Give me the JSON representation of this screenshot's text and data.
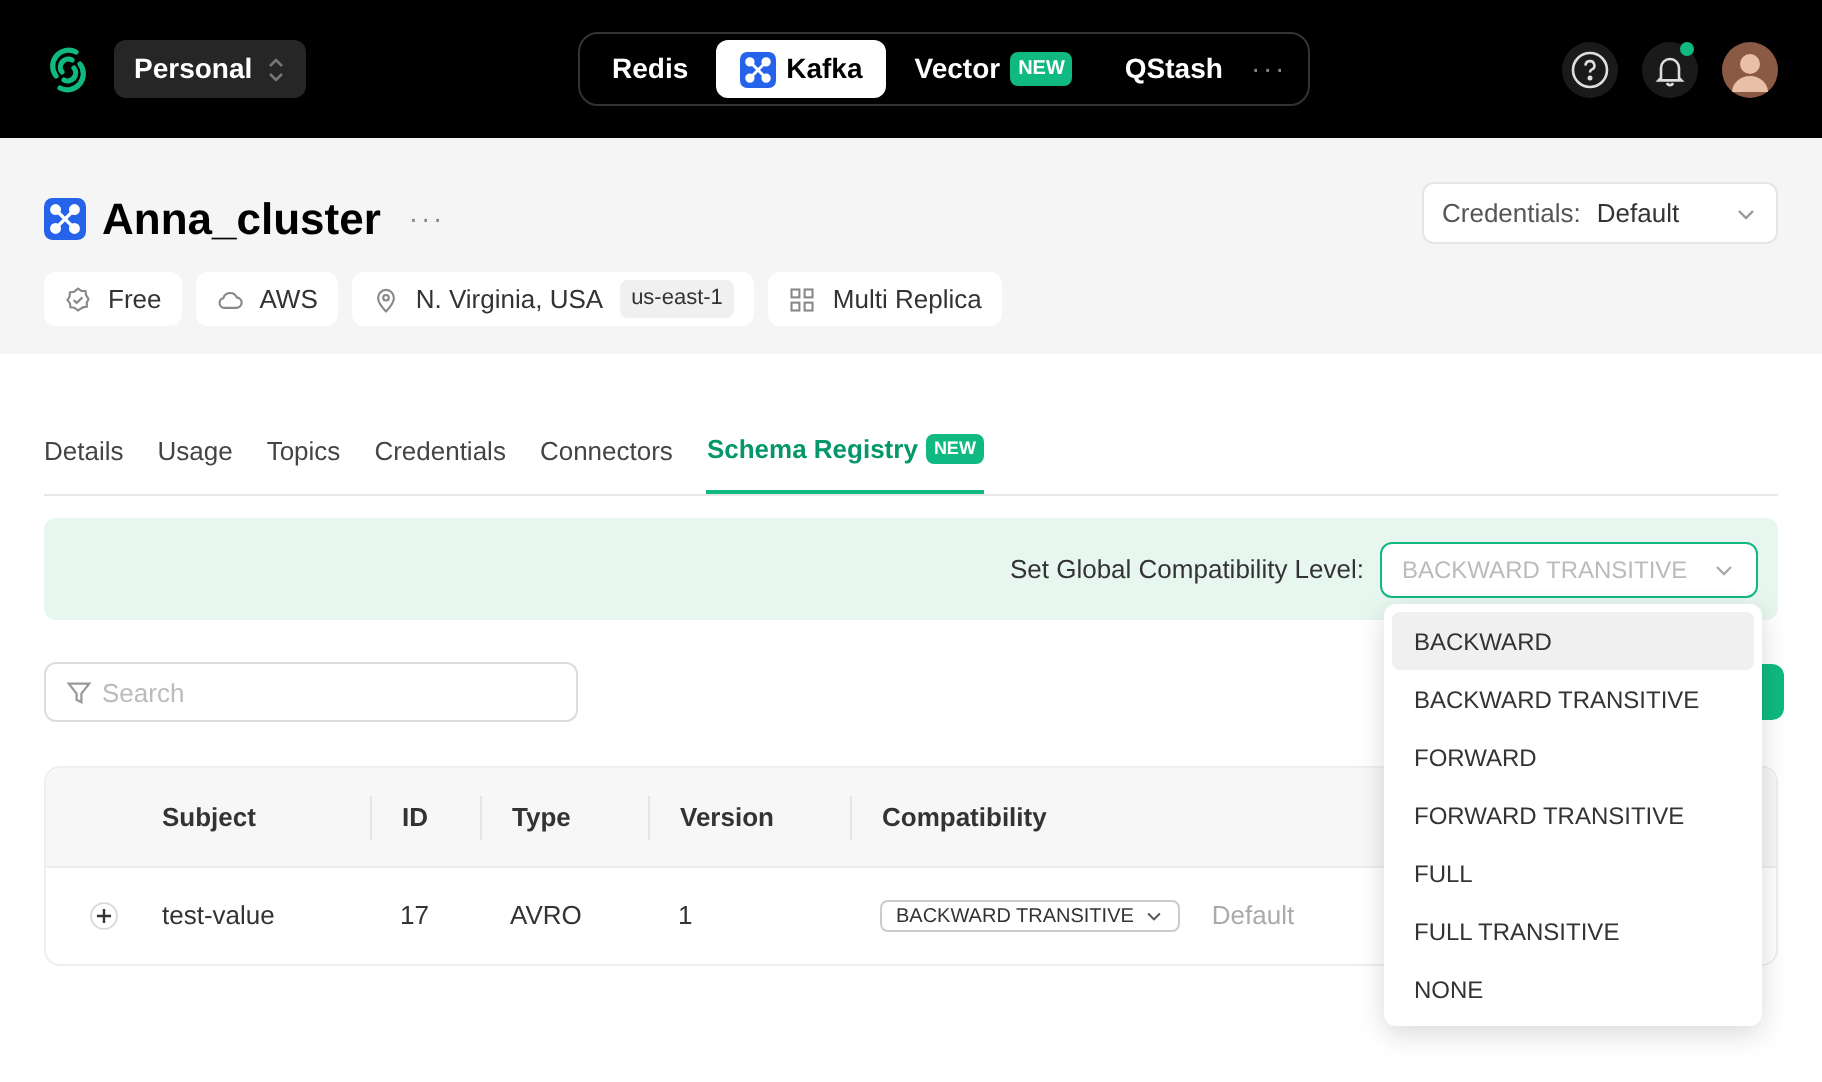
{
  "topbar": {
    "workspace": "Personal",
    "products": [
      {
        "label": "Redis",
        "selected": false
      },
      {
        "label": "Kafka",
        "selected": true
      },
      {
        "label": "Vector",
        "selected": false,
        "badge": "NEW"
      },
      {
        "label": "QStash",
        "selected": false
      }
    ],
    "more": "···",
    "has_notification": true
  },
  "cluster": {
    "name": "Anna_cluster",
    "more": "···",
    "tags": [
      {
        "kind": "plan",
        "label": "Free"
      },
      {
        "kind": "cloud",
        "label": "AWS"
      },
      {
        "kind": "region",
        "label": "N. Virginia, USA",
        "code": "us-east-1"
      },
      {
        "kind": "replica",
        "label": "Multi Replica"
      }
    ],
    "credentials": {
      "label": "Credentials:",
      "value": "Default"
    }
  },
  "tabs": [
    {
      "label": "Details",
      "selected": false
    },
    {
      "label": "Usage",
      "selected": false
    },
    {
      "label": "Topics",
      "selected": false
    },
    {
      "label": "Credentials",
      "selected": false
    },
    {
      "label": "Connectors",
      "selected": false
    },
    {
      "label": "Schema Registry",
      "selected": true,
      "badge": "NEW"
    }
  ],
  "global_level": {
    "label": "Set Global Compatibility Level:",
    "value": "BACKWARD TRANSITIVE",
    "options": [
      {
        "label": "BACKWARD",
        "highlighted": true
      },
      {
        "label": "BACKWARD TRANSITIVE",
        "highlighted": false
      },
      {
        "label": "FORWARD",
        "highlighted": false
      },
      {
        "label": "FORWARD TRANSITIVE",
        "highlighted": false
      },
      {
        "label": "FULL",
        "highlighted": false
      },
      {
        "label": "FULL TRANSITIVE",
        "highlighted": false
      },
      {
        "label": "NONE",
        "highlighted": false
      }
    ]
  },
  "search": {
    "placeholder": "Search"
  },
  "table": {
    "columns": [
      "Subject",
      "ID",
      "Type",
      "Version",
      "Compatibility"
    ],
    "rows": [
      {
        "subject": "test-value",
        "id": "17",
        "type": "AVRO",
        "version": "1",
        "compatibility": "BACKWARD TRANSITIVE",
        "note": "Default"
      }
    ]
  }
}
